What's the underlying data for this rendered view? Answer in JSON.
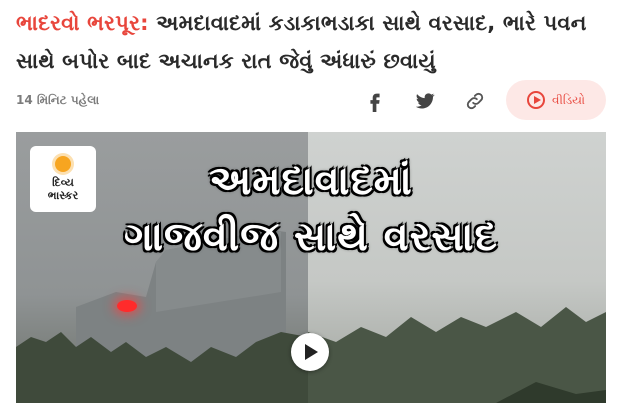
{
  "article": {
    "headline_kicker": "ભાદરવો ભરપૂર:",
    "headline_text": " અમદાવાદમાં કડાકાભડાકા સાથે વરસાદ, ભારે પવન સાથે બપોર બાદ અચાનક રાત જેવું અંધારું છવાયું",
    "time_ago": "14 મિનિટ પહેલા"
  },
  "share": {
    "icons": [
      "facebook-icon",
      "twitter-icon",
      "link-icon"
    ]
  },
  "video_pill": {
    "label": "વીડિયો",
    "icon": "play-circle-icon"
  },
  "media": {
    "logo_line1": "દિવ્ય",
    "logo_line2": "ભાસ્કર",
    "overlay_line1": "અમદાવાદમાં",
    "overlay_line2": "ગાજવીજ સાથે વરસાદ",
    "play_icon": "play-icon"
  },
  "colors": {
    "accent": "#e8463c",
    "pill_bg": "#fde8e6",
    "headline": "#2a2a2a"
  }
}
